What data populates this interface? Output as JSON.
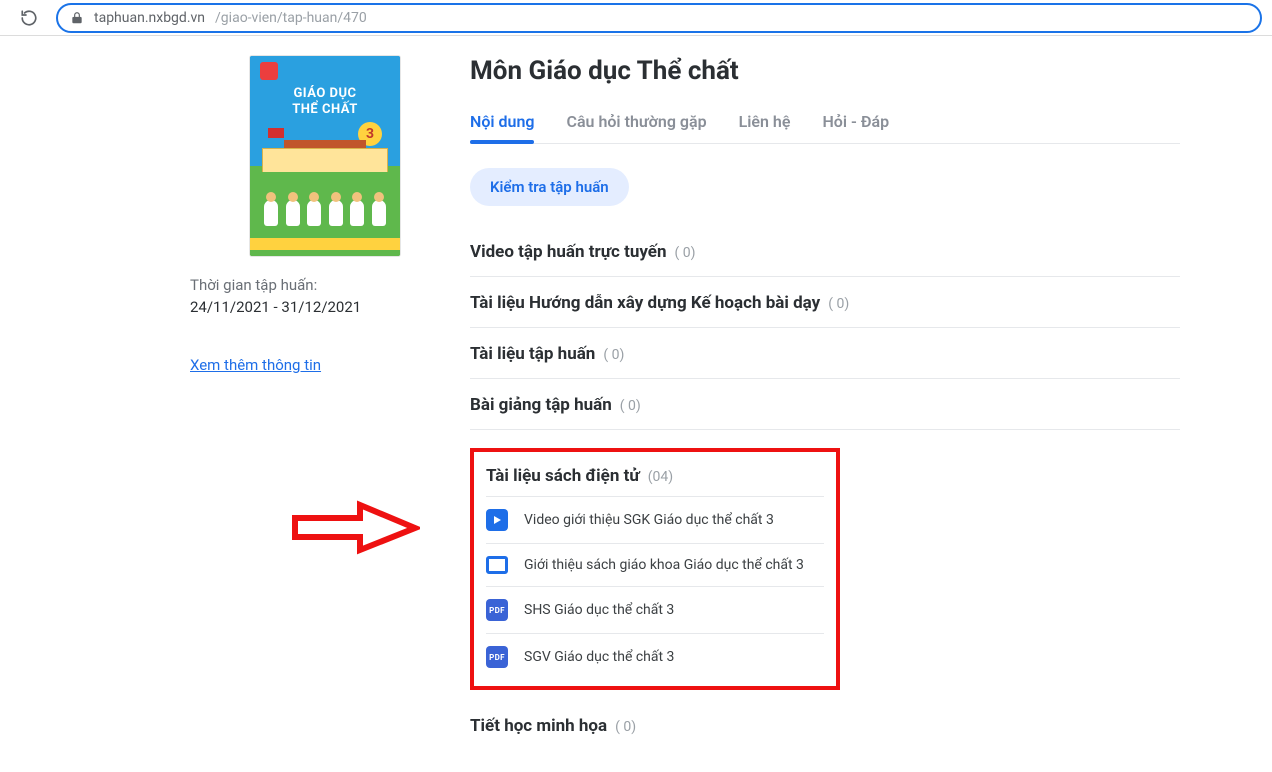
{
  "browser": {
    "host": "taphuan.nxbgd.vn",
    "path": "/giao-vien/tap-huan/470"
  },
  "cover": {
    "line1": "GIÁO DỤC",
    "line2": "THỂ CHẤT",
    "grade": "3"
  },
  "sidebar": {
    "time_label": "Thời gian tập huấn:",
    "time_value": "24/11/2021 - 31/12/2021",
    "more_link": "Xem thêm thông tin"
  },
  "title": "Môn Giáo dục Thể chất",
  "tabs": [
    "Nội dung",
    "Câu hỏi thường gặp",
    "Liên hệ",
    "Hỏi - Đáp"
  ],
  "pill": "Kiểm tra tập huấn",
  "sections": [
    {
      "title": "Video tập huấn trực tuyến",
      "count": "( 0)"
    },
    {
      "title": "Tài liệu Hướng dẫn xây dựng Kế hoạch bài dạy",
      "count": "( 0)"
    },
    {
      "title": "Tài liệu tập huấn",
      "count": "( 0)"
    },
    {
      "title": "Bài giảng tập huấn",
      "count": "( 0)"
    }
  ],
  "ebook": {
    "title": "Tài liệu sách điện tử",
    "count": "(04)",
    "items": [
      {
        "icon": "play",
        "label": "Video giới thiệu SGK Giáo dục thể chất 3"
      },
      {
        "icon": "frame",
        "label": "Giới thiệu sách giáo khoa Giáo dục thể chất 3"
      },
      {
        "icon": "pdf",
        "label": "SHS Giáo dục thể chất 3"
      },
      {
        "icon": "pdf",
        "label": "SGV Giáo dục thể chất 3"
      }
    ]
  },
  "footer_section": {
    "title": "Tiết học minh họa",
    "count": "( 0)"
  },
  "pdf_badge": "PDF"
}
